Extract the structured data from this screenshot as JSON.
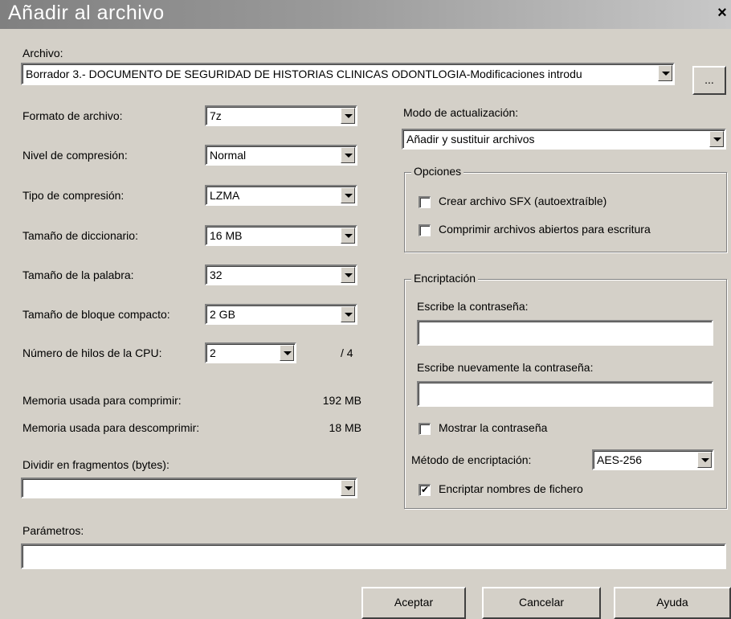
{
  "window": {
    "title": "Añadir al archivo",
    "close": "×"
  },
  "archive": {
    "label": "Archivo:",
    "value": "Borrador 3.- DOCUMENTO DE SEGURIDAD DE HISTORIAS CLINICAS ODONTLOGIA-Modificaciones introdu",
    "browse": "..."
  },
  "left": {
    "format_label": "Formato de archivo:",
    "format_value": "7z",
    "level_label": "Nivel de compresión:",
    "level_value": "Normal",
    "type_label": "Tipo de compresión:",
    "type_value": "LZMA",
    "dict_label": "Tamaño de diccionario:",
    "dict_value": "16 MB",
    "word_label": "Tamaño de la palabra:",
    "word_value": "32",
    "solid_label": "Tamaño de bloque compacto:",
    "solid_value": "2 GB",
    "threads_label": "Número de hilos de la CPU:",
    "threads_value": "2",
    "threads_total": "/ 4",
    "mem_comp_label": "Memoria usada para comprimir:",
    "mem_comp_value": "192 MB",
    "mem_decomp_label": "Memoria usada para descomprimir:",
    "mem_decomp_value": "18 MB",
    "split_label": "Dividir en fragmentos (bytes):",
    "split_value": ""
  },
  "right": {
    "update_label": "Modo de actualización:",
    "update_value": "Añadir y sustituir archivos",
    "options_title": "Opciones",
    "sfx_label": "Crear archivo SFX (autoextraíble)",
    "sfx_checked": false,
    "shared_label": "Comprimir archivos abiertos para escritura",
    "shared_checked": false,
    "enc_title": "Encriptación",
    "pwd_label": "Escribe la contraseña:",
    "pwd_value": "",
    "pwd2_label": "Escribe nuevamente la contraseña:",
    "pwd2_value": "",
    "show_pwd_label": "Mostrar la contraseña",
    "show_pwd_checked": false,
    "method_label": "Método de encriptación:",
    "method_value": "AES-256",
    "enc_names_label": "Encriptar nombres de fichero",
    "enc_names_checked": true,
    "check_mark": "✔"
  },
  "params": {
    "label": "Parámetros:",
    "value": ""
  },
  "buttons": {
    "ok": "Aceptar",
    "cancel": "Cancelar",
    "help": "Ayuda"
  }
}
